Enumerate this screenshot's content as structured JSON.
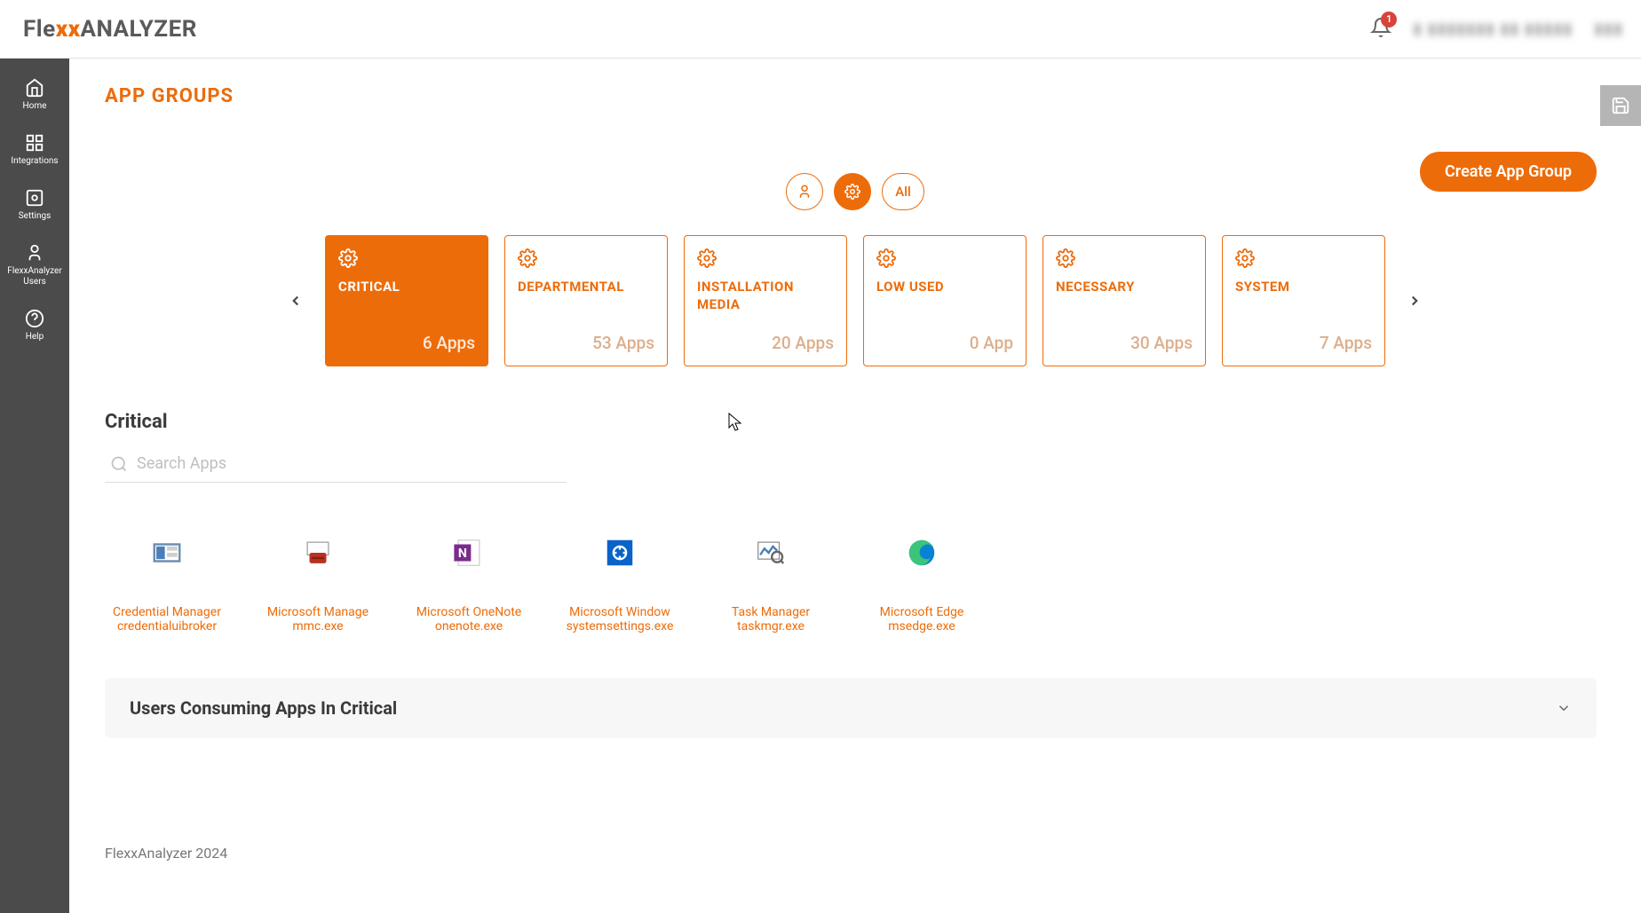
{
  "header": {
    "logo_prefix": "Fle",
    "logo_xx": "xx",
    "logo_suffix": "ANALYZER",
    "notification_count": "1"
  },
  "sidebar": {
    "items": [
      {
        "label": "Home"
      },
      {
        "label": "Integrations"
      },
      {
        "label": "Settings"
      },
      {
        "label": "FlexxAnalyzer Users"
      },
      {
        "label": "Help"
      }
    ]
  },
  "page": {
    "title": "APP GROUPS",
    "create_button": "Create App Group",
    "filter_all": "All"
  },
  "cards": [
    {
      "title": "CRITICAL",
      "count": "6 Apps",
      "active": true
    },
    {
      "title": "DEPARTMENTAL",
      "count": "53 Apps",
      "active": false
    },
    {
      "title": "INSTALLATION MEDIA",
      "count": "20 Apps",
      "active": false
    },
    {
      "title": "LOW USED",
      "count": "0 App",
      "active": false
    },
    {
      "title": "NECESSARY",
      "count": "30 Apps",
      "active": false
    },
    {
      "title": "SYSTEM",
      "count": "7 Apps",
      "active": false
    }
  ],
  "section": {
    "title": "Critical",
    "search_placeholder": "Search Apps"
  },
  "apps": [
    {
      "name": "Credential Manager",
      "exe": "credentialuibroker"
    },
    {
      "name": "Microsoft Manage",
      "exe": "mmc.exe"
    },
    {
      "name": "Microsoft OneNote",
      "exe": "onenote.exe"
    },
    {
      "name": "Microsoft Window",
      "exe": "systemsettings.exe"
    },
    {
      "name": "Task Manager",
      "exe": "taskmgr.exe"
    },
    {
      "name": "Microsoft Edge",
      "exe": "msedge.exe"
    }
  ],
  "expand": {
    "title": "Users Consuming Apps In Critical"
  },
  "footer": {
    "text": "FlexxAnalyzer 2024"
  }
}
